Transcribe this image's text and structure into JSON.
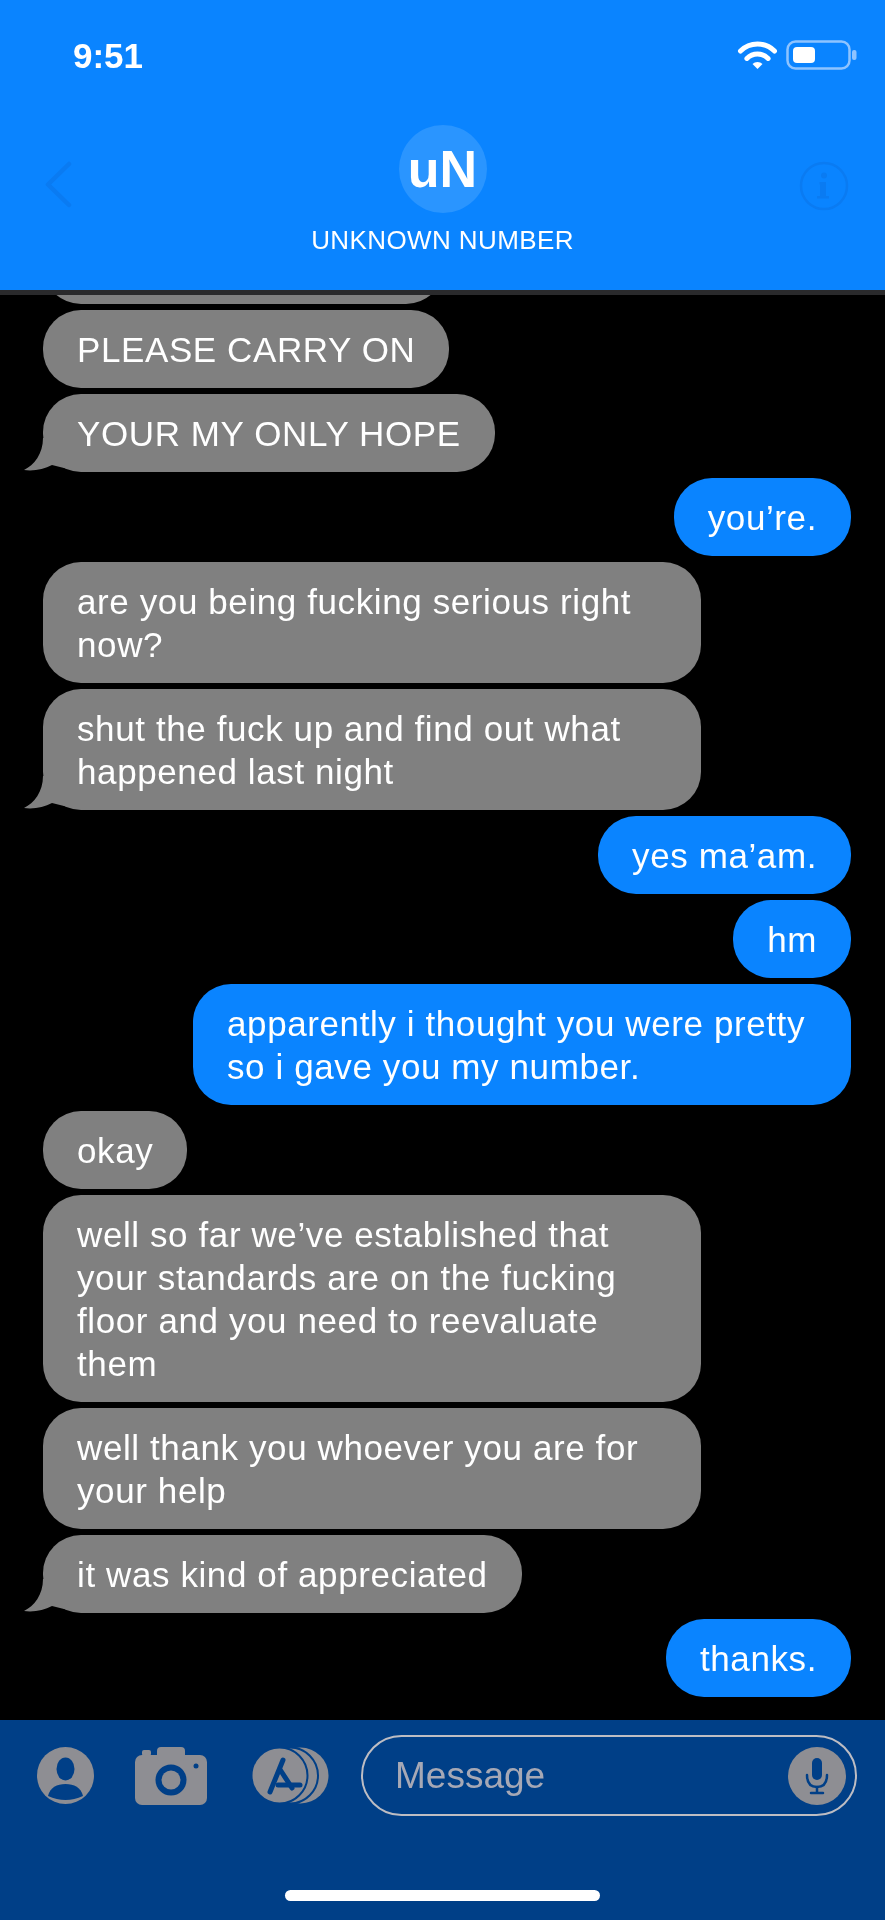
{
  "status_bar": {
    "time": "9:51"
  },
  "header": {
    "avatar_initials": "uN",
    "contact_name": "UNKNOWN NUMBER"
  },
  "messages": [
    {
      "kind": "received_cut_off"
    },
    {
      "kind": "received",
      "text": "PLEASE CARRY ON",
      "tail": false
    },
    {
      "kind": "received",
      "text": "YOUR MY ONLY HOPE",
      "tail": true
    },
    {
      "kind": "sent",
      "text": "you’re.",
      "tail": false
    },
    {
      "kind": "received",
      "text": "are you being fucking serious right now?",
      "tail": false
    },
    {
      "kind": "received",
      "text": "shut the fuck up and find out what happened last night",
      "tail": true
    },
    {
      "kind": "sent",
      "text": "yes ma’am.",
      "tail": false
    },
    {
      "kind": "sent",
      "text": "hm",
      "tail": false
    },
    {
      "kind": "sent",
      "text": "apparently i thought you were pretty so i gave you my number.",
      "tail": false
    },
    {
      "kind": "received",
      "text": "okay",
      "tail": false
    },
    {
      "kind": "received",
      "text": "well so far we’ve established that your standards are on the fucking floor and you need to reevaluate them",
      "tail": false
    },
    {
      "kind": "received",
      "text": "well thank you whoever you are for your help",
      "tail": false
    },
    {
      "kind": "received",
      "text": "it was kind of appreciated",
      "tail": true
    },
    {
      "kind": "sent",
      "text": "thanks.",
      "tail": false
    }
  ],
  "composer": {
    "placeholder": "Message"
  }
}
